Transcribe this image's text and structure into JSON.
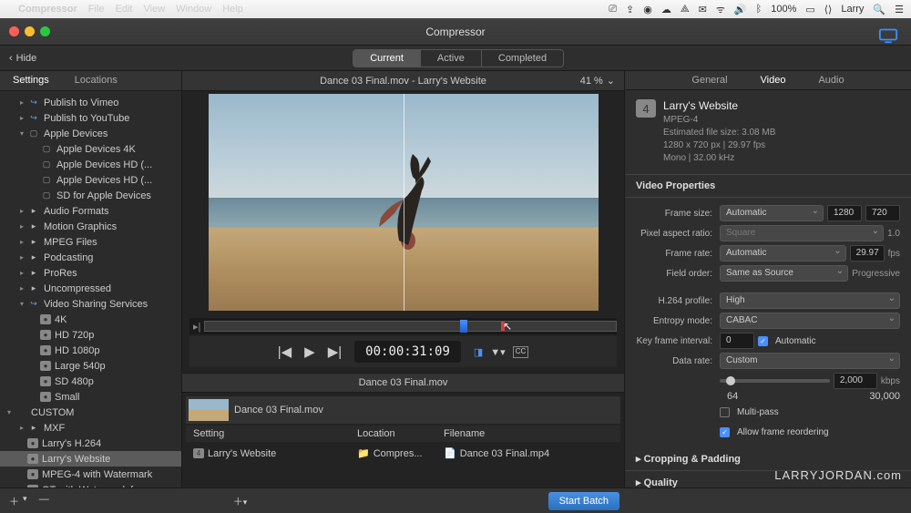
{
  "menubar": {
    "app": "Compressor",
    "items": [
      "File",
      "Edit",
      "View",
      "Window",
      "Help"
    ],
    "battery": "100%",
    "user": "Larry"
  },
  "titlebar": {
    "title": "Compressor"
  },
  "toolbar": {
    "hide": "Hide",
    "tabs": {
      "current": "Current",
      "active": "Active",
      "completed": "Completed"
    }
  },
  "sidebar": {
    "tabs": {
      "settings": "Settings",
      "locations": "Locations"
    },
    "tree": [
      {
        "indent": 1,
        "arrow": "▸",
        "icon": "svc",
        "label": "Publish to Vimeo"
      },
      {
        "indent": 1,
        "arrow": "▸",
        "icon": "svc",
        "label": "Publish to YouTube"
      },
      {
        "indent": 1,
        "arrow": "▾",
        "icon": "dev",
        "label": "Apple Devices"
      },
      {
        "indent": 2,
        "arrow": "",
        "icon": "dev",
        "label": "Apple Devices 4K"
      },
      {
        "indent": 2,
        "arrow": "",
        "icon": "dev",
        "label": "Apple Devices HD (..."
      },
      {
        "indent": 2,
        "arrow": "",
        "icon": "dev",
        "label": "Apple Devices HD (..."
      },
      {
        "indent": 2,
        "arrow": "",
        "icon": "dev",
        "label": "SD for Apple Devices"
      },
      {
        "indent": 1,
        "arrow": "▸",
        "icon": "fmt",
        "label": "Audio Formats"
      },
      {
        "indent": 1,
        "arrow": "▸",
        "icon": "fmt",
        "label": "Motion Graphics"
      },
      {
        "indent": 1,
        "arrow": "▸",
        "icon": "fmt",
        "label": "MPEG Files"
      },
      {
        "indent": 1,
        "arrow": "▸",
        "icon": "fmt",
        "label": "Podcasting"
      },
      {
        "indent": 1,
        "arrow": "▸",
        "icon": "fmt",
        "label": "ProRes"
      },
      {
        "indent": 1,
        "arrow": "▸",
        "icon": "fmt",
        "label": "Uncompressed"
      },
      {
        "indent": 1,
        "arrow": "▾",
        "icon": "svc",
        "label": "Video Sharing Services"
      },
      {
        "indent": 2,
        "arrow": "",
        "icon": "prof",
        "label": "4K"
      },
      {
        "indent": 2,
        "arrow": "",
        "icon": "prof",
        "label": "HD 720p"
      },
      {
        "indent": 2,
        "arrow": "",
        "icon": "prof",
        "label": "HD 1080p"
      },
      {
        "indent": 2,
        "arrow": "",
        "icon": "prof",
        "label": "Large 540p"
      },
      {
        "indent": 2,
        "arrow": "",
        "icon": "prof",
        "label": "SD 480p"
      },
      {
        "indent": 2,
        "arrow": "",
        "icon": "prof",
        "label": "Small"
      },
      {
        "indent": 0,
        "arrow": "▾",
        "icon": "",
        "label": "CUSTOM"
      },
      {
        "indent": 1,
        "arrow": "▸",
        "icon": "fmt",
        "label": "MXF"
      },
      {
        "indent": 1,
        "arrow": "",
        "icon": "prof",
        "label": "Larry's H.264"
      },
      {
        "indent": 1,
        "arrow": "",
        "icon": "prof",
        "label": "Larry's Website",
        "selected": true
      },
      {
        "indent": 1,
        "arrow": "",
        "icon": "prof",
        "label": "MPEG-4 with Watermark"
      },
      {
        "indent": 1,
        "arrow": "",
        "icon": "prof",
        "label": "QT with Watermark for..."
      }
    ]
  },
  "center": {
    "header": "Dance 03 Final.mov - Larry's Website",
    "zoom": "41 %",
    "timecode": "00:00:31:09",
    "batch_title": "Dance 03 Final.mov",
    "item_name": "Dance 03 Final.mov",
    "cols": {
      "setting": "Setting",
      "location": "Location",
      "filename": "Filename"
    },
    "row": {
      "setting": "Larry's Website",
      "location": "Compres...",
      "filename": "Dance 03 Final.mp4"
    }
  },
  "inspector": {
    "tabs": {
      "general": "General",
      "video": "Video",
      "audio": "Audio"
    },
    "name": "Larry's Website",
    "codec": "MPEG-4",
    "filesize": "Estimated file size: 3.08 MB",
    "dimensions": "1280 x 720 px | 29.97 fps",
    "audio": "Mono | 32.00 kHz",
    "video_props_title": "Video Properties",
    "labels": {
      "frame_size": "Frame size:",
      "pixel_aspect": "Pixel aspect ratio:",
      "frame_rate": "Frame rate:",
      "field_order": "Field order:",
      "h264_profile": "H.264 profile:",
      "entropy": "Entropy mode:",
      "key_frame": "Key frame interval:",
      "data_rate": "Data rate:"
    },
    "values": {
      "frame_size": "Automatic",
      "w": "1280",
      "h": "720",
      "pixel_aspect": "Square",
      "par": "1.0",
      "frame_rate": "Automatic",
      "fps": "29.97",
      "fps_unit": "fps",
      "field_order": "Same as Source",
      "field_out": "Progressive",
      "h264": "High",
      "entropy": "CABAC",
      "keyint": "0",
      "kf_auto": "Automatic",
      "data_rate": "Custom",
      "kbps": "2,000",
      "kbps_unit": "kbps",
      "slider_min": "64",
      "slider_max": "30,000",
      "multipass": "Multi-pass",
      "reorder": "Allow frame reordering"
    },
    "crop_title": "Cropping & Padding",
    "quality_title": "Quality"
  },
  "bottom": {
    "start": "Start Batch"
  },
  "watermark": "LARRYJORDAN.com"
}
